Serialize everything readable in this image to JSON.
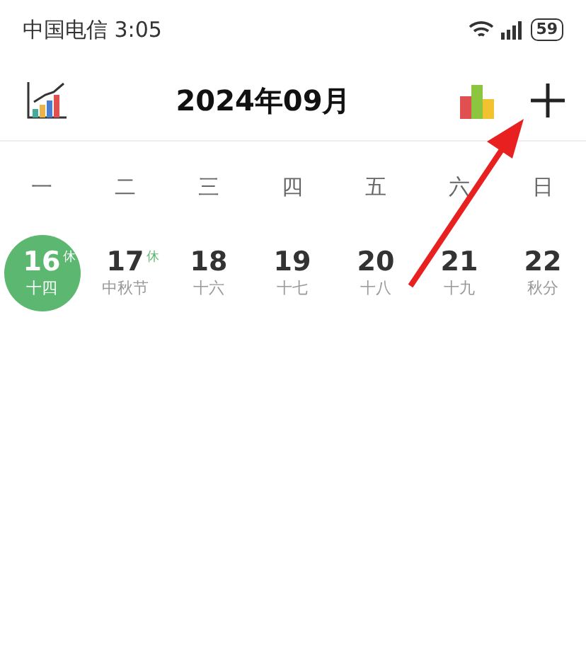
{
  "status_bar": {
    "carrier": "中国电信 3:05",
    "battery": "59"
  },
  "header": {
    "title": "2024年09月"
  },
  "weekdays": [
    "一",
    "二",
    "三",
    "四",
    "五",
    "六",
    "日"
  ],
  "days": [
    {
      "day": "16",
      "lunar": "十四",
      "holiday": "休",
      "selected": true
    },
    {
      "day": "17",
      "lunar": "中秋节",
      "holiday": "休",
      "selected": false
    },
    {
      "day": "18",
      "lunar": "十六",
      "selected": false
    },
    {
      "day": "19",
      "lunar": "十七",
      "selected": false
    },
    {
      "day": "20",
      "lunar": "十八",
      "selected": false
    },
    {
      "day": "21",
      "lunar": "十九",
      "selected": false
    },
    {
      "day": "22",
      "lunar": "秋分",
      "selected": false
    }
  ]
}
